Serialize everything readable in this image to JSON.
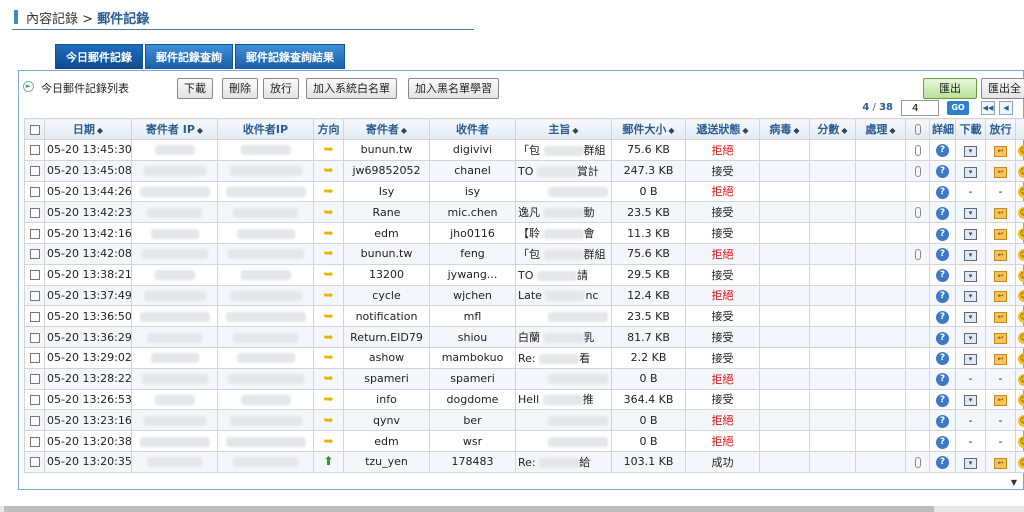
{
  "breadcrumb": {
    "parent": "內容記錄",
    "separator": ">",
    "current": "郵件記錄"
  },
  "tabs": [
    {
      "label": "今日郵件記錄",
      "active": true
    },
    {
      "label": "郵件記錄查詢",
      "active": false
    },
    {
      "label": "郵件記錄查詢結果",
      "active": false
    }
  ],
  "toolbar": {
    "list_title": "今日郵件記錄列表",
    "download_label": "下載",
    "delete_label": "刪除",
    "release_label": "放行",
    "whitelist_label": "加入系統白名單",
    "blacklist_label": "加入黑名單學習",
    "export_label": "匯出",
    "export_all_label": "匯出全"
  },
  "pager": {
    "current": "4",
    "total": "38",
    "page_value": "4",
    "go_label": "GO"
  },
  "columns": [
    "日期",
    "寄件者 IP",
    "收件者IP",
    "方向",
    "寄件者",
    "收件者",
    "主旨",
    "郵件大小",
    "遞送狀態",
    "病毒",
    "分數",
    "處理",
    "附件",
    "詳細",
    "下載",
    "放行"
  ],
  "colors": {
    "rejected": "#dd1111",
    "accent": "#2a5d92"
  },
  "rows": [
    {
      "date": "05-20 13:45:30",
      "dir": "in",
      "sender": "bunun.tw",
      "recipient": "digivivi",
      "subject": "「包",
      "subject_tail": "群組",
      "size": "75.6 KB",
      "status": "拒絕",
      "attach": true,
      "dl": true,
      "rel": true
    },
    {
      "date": "05-20 13:45:08",
      "dir": "in",
      "sender": "jw69852052",
      "recipient": "chanel",
      "subject": "TO",
      "subject_tail": "賞計",
      "size": "247.3 KB",
      "status": "接受",
      "attach": true,
      "dl": true,
      "rel": true
    },
    {
      "date": "05-20 13:44:26",
      "dir": "in",
      "sender": "Isy",
      "recipient": "isy",
      "subject": "",
      "subject_tail": "",
      "size": "0 B",
      "status": "拒絕",
      "attach": false,
      "dl": false,
      "rel": false
    },
    {
      "date": "05-20 13:42:23",
      "dir": "in",
      "sender": "Rane",
      "recipient": "mic.chen",
      "subject": "逸凡",
      "subject_tail": "動",
      "size": "23.5 KB",
      "status": "接受",
      "attach": true,
      "dl": true,
      "rel": true
    },
    {
      "date": "05-20 13:42:16",
      "dir": "in",
      "sender": "edm",
      "recipient": "jho0116",
      "subject": "【聆",
      "subject_tail": "會",
      "size": "11.3 KB",
      "status": "接受",
      "attach": false,
      "dl": true,
      "rel": true
    },
    {
      "date": "05-20 13:42:08",
      "dir": "in",
      "sender": "bunun.tw",
      "recipient": "feng",
      "subject": "「包",
      "subject_tail": "群組",
      "size": "75.6 KB",
      "status": "拒絕",
      "attach": true,
      "dl": true,
      "rel": true
    },
    {
      "date": "05-20 13:38:21",
      "dir": "in",
      "sender": "13200",
      "recipient": "jywang...",
      "subject": "TO",
      "subject_tail": "請",
      "size": "29.5 KB",
      "status": "接受",
      "attach": false,
      "dl": true,
      "rel": true
    },
    {
      "date": "05-20 13:37:49",
      "dir": "in",
      "sender": "cycle",
      "recipient": "wjchen",
      "subject": "Late",
      "subject_tail": "nc",
      "size": "12.4 KB",
      "status": "拒絕",
      "attach": false,
      "dl": true,
      "rel": true
    },
    {
      "date": "05-20 13:36:50",
      "dir": "in",
      "sender": "notification",
      "recipient": "mfl",
      "subject": "",
      "subject_tail": "",
      "size": "23.5 KB",
      "status": "接受",
      "attach": false,
      "dl": true,
      "rel": true
    },
    {
      "date": "05-20 13:36:29",
      "dir": "in",
      "sender": "Return.EID79",
      "recipient": "shiou",
      "subject": "白蘭",
      "subject_tail": "乳",
      "size": "81.7 KB",
      "status": "接受",
      "attach": false,
      "dl": true,
      "rel": true
    },
    {
      "date": "05-20 13:29:02",
      "dir": "in",
      "sender": "ashow",
      "recipient": "mambokuo",
      "subject": "Re:",
      "subject_tail": "看",
      "size": "2.2 KB",
      "status": "接受",
      "attach": false,
      "dl": true,
      "rel": true
    },
    {
      "date": "05-20 13:28:22",
      "dir": "in",
      "sender": "spameri",
      "recipient": "spameri",
      "subject": "",
      "subject_tail": "",
      "size": "0 B",
      "status": "拒絕",
      "attach": false,
      "dl": false,
      "rel": false
    },
    {
      "date": "05-20 13:26:53",
      "dir": "in",
      "sender": "info",
      "recipient": "dogdome",
      "subject": "Hell",
      "subject_tail": "推",
      "size": "364.4 KB",
      "status": "接受",
      "attach": false,
      "dl": true,
      "rel": true
    },
    {
      "date": "05-20 13:23:16",
      "dir": "in",
      "sender": "qynv",
      "recipient": "ber",
      "subject": "",
      "subject_tail": "",
      "size": "0 B",
      "status": "拒絕",
      "attach": false,
      "dl": false,
      "rel": false
    },
    {
      "date": "05-20 13:20:38",
      "dir": "in",
      "sender": "edm",
      "recipient": "wsr",
      "subject": "",
      "subject_tail": "",
      "size": "0 B",
      "status": "拒絕",
      "attach": false,
      "dl": false,
      "rel": false
    },
    {
      "date": "05-20 13:20:35",
      "dir": "out",
      "sender": "tzu_yen",
      "recipient": "178483",
      "subject": "Re:",
      "subject_tail": "給",
      "size": "103.1 KB",
      "status": "成功",
      "attach": true,
      "dl": true,
      "rel": true
    }
  ]
}
